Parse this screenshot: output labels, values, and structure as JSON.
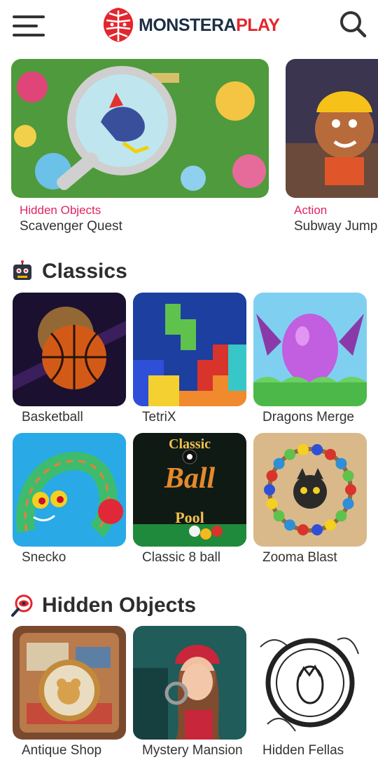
{
  "header": {
    "logo_part1": "MONSTERA",
    "logo_part2": "PLAY",
    "menu_icon": "hamburger-menu-icon",
    "search_icon": "search-icon"
  },
  "featured": [
    {
      "category": "Hidden Objects",
      "title": "Scavenger Quest"
    },
    {
      "category": "Action",
      "title": "Subway Jump"
    }
  ],
  "sections": [
    {
      "title": "Classics",
      "icon": "robot-icon",
      "games": [
        {
          "name": "Basketball"
        },
        {
          "name": "TetriX"
        },
        {
          "name": "Dragons Merge"
        },
        {
          "name": "Snecko"
        },
        {
          "name": "Classic 8 ball"
        },
        {
          "name": "Zooma Blast"
        }
      ]
    },
    {
      "title": "Hidden Objects",
      "icon": "magnifier-eye-icon",
      "games": [
        {
          "name": "Antique Shop"
        },
        {
          "name": "Mystery Mansion"
        },
        {
          "name": "Hidden Fellas"
        }
      ]
    }
  ],
  "thumb_text": {
    "classic": "Classic",
    "ball": "Ball",
    "pool": "Pool"
  },
  "colors": {
    "brand_dark": "#1c2f45",
    "brand_red": "#e3262e",
    "category_pink": "#e0245e"
  }
}
